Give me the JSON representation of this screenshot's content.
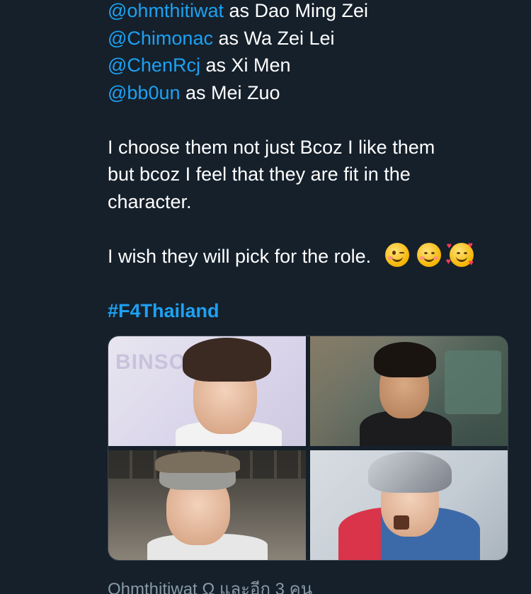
{
  "tweet": {
    "lines": [
      {
        "mention": "@ohmthitiwat",
        "text": " as Dao Ming Zei"
      },
      {
        "mention": "@Chimonac",
        "text": " as Wa Zei Lei"
      },
      {
        "mention": "@ChenRcj",
        "text": " as Xi Men"
      },
      {
        "mention": "@bb0un",
        "text": " as Mei Zuo"
      }
    ],
    "paragraph_1_line_1": "I choose them not just Bcoz I like them",
    "paragraph_1_line_2": "but bcoz I feel that they are fit in the",
    "paragraph_1_line_3": "character.",
    "paragraph_2": "I wish they will pick for the role.",
    "emojis": [
      "winking-face-emoji",
      "smiling-face-emoji",
      "smiling-face-with-hearts-emoji"
    ],
    "hashtag": "#F4Thailand"
  },
  "media": {
    "photos": [
      {
        "name": "photo-1",
        "watermark": "BINSO"
      },
      {
        "name": "photo-2"
      },
      {
        "name": "photo-3"
      },
      {
        "name": "photo-4"
      }
    ]
  },
  "footer": {
    "tagged_text": "Ohmthitiwat Ω และอีก 3 คน"
  },
  "colors": {
    "background": "#15202b",
    "link": "#1da1f2",
    "muted": "#8899a6"
  }
}
